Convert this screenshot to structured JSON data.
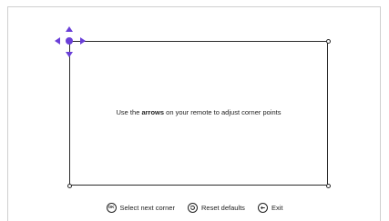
{
  "instruction": {
    "prefix": "Use the ",
    "emphasis": "arrows",
    "suffix": " on your remote to adjust corner points"
  },
  "hints": {
    "ok_glyph": "OK",
    "select_next": "Select next corner",
    "reset": "Reset defaults",
    "exit": "Exit"
  },
  "colors": {
    "accent": "#6a3fd8",
    "frame": "#2a2a2a",
    "text": "#222222"
  },
  "icons": {
    "ok": "ok-button-icon",
    "reset": "reset-icon",
    "exit": "back-arrow-icon",
    "arrows": [
      "arrow-up-icon",
      "arrow-down-icon",
      "arrow-left-icon",
      "arrow-right-icon"
    ]
  }
}
